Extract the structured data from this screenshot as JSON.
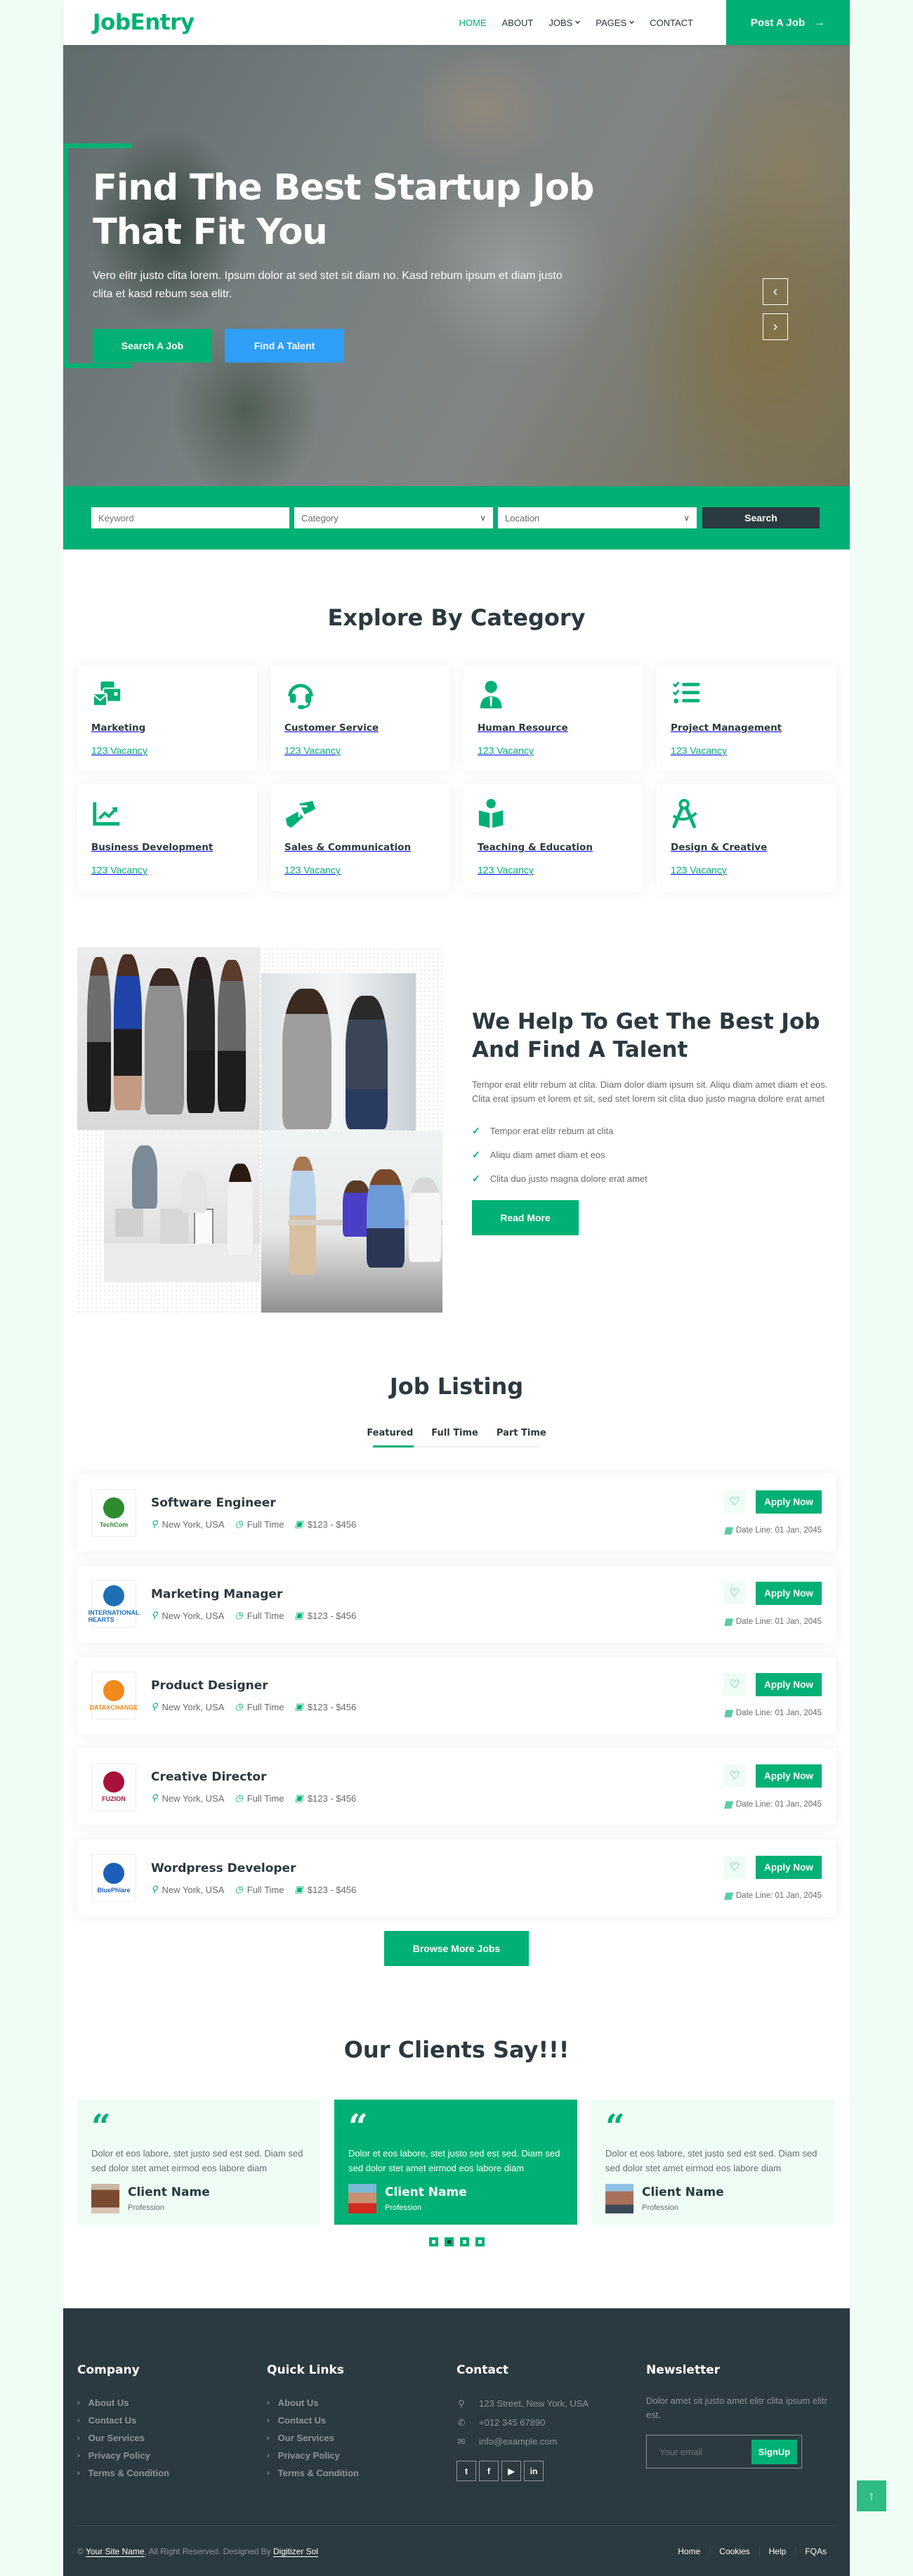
{
  "brand": {
    "name": "JobEntry",
    "accent": "#00b074",
    "dark": "#2b3940",
    "secondary": "#2f9ef6"
  },
  "nav": {
    "items": [
      {
        "label": "HOME",
        "active": true,
        "dropdown": false
      },
      {
        "label": "ABOUT",
        "active": false,
        "dropdown": false
      },
      {
        "label": "JOBS",
        "active": false,
        "dropdown": true
      },
      {
        "label": "PAGES",
        "active": false,
        "dropdown": true
      },
      {
        "label": "CONTACT",
        "active": false,
        "dropdown": false
      }
    ],
    "cta_label": "Post A Job",
    "cta_icon": "arrow-right-icon"
  },
  "hero": {
    "title": "Find The Best Startup Job That Fit You",
    "subtitle": "Vero elitr justo clita lorem. Ipsum dolor at sed stet sit diam no. Kasd rebum ipsum et diam justo clita et kasd rebum sea elitr.",
    "primary_button": "Search A Job",
    "secondary_button": "Find A Talent",
    "prev_icon": "‹",
    "next_icon": "›"
  },
  "search": {
    "keyword_placeholder": "Keyword",
    "category_selected": "Category",
    "location_selected": "Location",
    "button_label": "Search"
  },
  "categories": {
    "title": "Explore By Category",
    "items": [
      {
        "icon": "mail-bulk-icon",
        "name": "Marketing",
        "vacancy": "123 Vacancy"
      },
      {
        "icon": "headset-icon",
        "name": "Customer Service",
        "vacancy": "123 Vacancy"
      },
      {
        "icon": "user-tie-icon",
        "name": "Human Resource",
        "vacancy": "123 Vacancy"
      },
      {
        "icon": "tasks-icon",
        "name": "Project Management",
        "vacancy": "123 Vacancy"
      },
      {
        "icon": "chart-line-icon",
        "name": "Business Development",
        "vacancy": "123 Vacancy"
      },
      {
        "icon": "handshake-icon",
        "name": "Sales & Communication",
        "vacancy": "123 Vacancy"
      },
      {
        "icon": "book-reader-icon",
        "name": "Teaching & Education",
        "vacancy": "123 Vacancy"
      },
      {
        "icon": "drafting-compass-icon",
        "name": "Design & Creative",
        "vacancy": "123 Vacancy"
      }
    ]
  },
  "about": {
    "title": "We Help To Get The Best Job And Find A Talent",
    "text": "Tempor erat elitr rebum at clita. Diam dolor diam ipsum sit. Aliqu diam amet diam et eos. Clita erat ipsum et lorem et sit, sed stet lorem sit clita duo justo magna dolore erat amet",
    "checks": [
      "Tempor erat elitr rebum at clita",
      "Aliqu diam amet diam et eos",
      "Clita duo justo magna dolore erat amet"
    ],
    "button_label": "Read More"
  },
  "jobs": {
    "title": "Job Listing",
    "tabs": [
      {
        "label": "Featured",
        "active": true
      },
      {
        "label": "Full Time",
        "active": false
      },
      {
        "label": "Part Time",
        "active": false
      }
    ],
    "items": [
      {
        "title": "Software Engineer",
        "company": "TechCom",
        "logo_color": "#2e8b2e",
        "location": "New York, USA",
        "type": "Full Time",
        "salary": "$123 - $456",
        "deadline": "Date Line: 01 Jan, 2045",
        "apply": "Apply Now"
      },
      {
        "title": "Marketing Manager",
        "company": "INTERNATIONAL HEARTS",
        "logo_color": "#1f6fb4",
        "location": "New York, USA",
        "type": "Full Time",
        "salary": "$123 - $456",
        "deadline": "Date Line: 01 Jan, 2045",
        "apply": "Apply Now"
      },
      {
        "title": "Product Designer",
        "company": "DATAXCHANGE",
        "logo_color": "#f28a1b",
        "location": "New York, USA",
        "type": "Full Time",
        "salary": "$123 - $456",
        "deadline": "Date Line: 01 Jan, 2045",
        "apply": "Apply Now"
      },
      {
        "title": "Creative Director",
        "company": "FUZION",
        "logo_color": "#a8123a",
        "location": "New York, USA",
        "type": "Full Time",
        "salary": "$123 - $456",
        "deadline": "Date Line: 01 Jan, 2045",
        "apply": "Apply Now"
      },
      {
        "title": "Wordpress Developer",
        "company": "BluePhlare",
        "logo_color": "#1c5fb8",
        "location": "New York, USA",
        "type": "Full Time",
        "salary": "$123 - $456",
        "deadline": "Date Line: 01 Jan, 2045",
        "apply": "Apply Now"
      }
    ],
    "browse_label": "Browse More Jobs"
  },
  "testimonials": {
    "title": "Our Clients Say!!!",
    "items": [
      {
        "text": "Dolor et eos labore, stet justo sed est sed. Diam sed sed dolor stet amet eirmod eos labore diam",
        "name": "Client Name",
        "profession": "Profession",
        "active": false,
        "avatar_color": "#8b5a3c"
      },
      {
        "text": "Dolor et eos labore, stet justo sed est sed. Diam sed sed dolor stet amet eirmod eos labore diam",
        "name": "Client Name",
        "profession": "Profession",
        "active": true,
        "avatar_color": "#d8312b"
      },
      {
        "text": "Dolor et eos labore, stet justo sed est sed. Diam sed sed dolor stet amet eirmod eos labore diam",
        "name": "Client Name",
        "profession": "Profession",
        "active": false,
        "avatar_color": "#4a5a66"
      }
    ],
    "dots": 4,
    "active_dot": 2
  },
  "footer": {
    "company": {
      "title": "Company",
      "links": [
        "About Us",
        "Contact Us",
        "Our Services",
        "Privacy Policy",
        "Terms & Condition"
      ]
    },
    "quick_links": {
      "title": "Quick Links",
      "links": [
        "About Us",
        "Contact Us",
        "Our Services",
        "Privacy Policy",
        "Terms & Condition"
      ]
    },
    "contact": {
      "title": "Contact",
      "address": "123 Street, New York, USA",
      "phone": "+012 345 67890",
      "email": "info@example.com",
      "socials": [
        "twitter-icon",
        "facebook-icon",
        "youtube-icon",
        "linkedin-icon"
      ]
    },
    "newsletter": {
      "title": "Newsletter",
      "text": "Dolor amet sit justo amet elitr clita ipsum elitr est.",
      "placeholder": "Your email",
      "button": "SignUp"
    },
    "copyright_prefix": "©",
    "site_name": "Your Site Name",
    "rights": ", All Right Reserved. Designed By ",
    "designer": "Digitizer Sol",
    "bottom_menu": [
      "Home",
      "Cookies",
      "Help",
      "FQAs"
    ]
  },
  "back_to_top_icon": "arrow-up-icon"
}
